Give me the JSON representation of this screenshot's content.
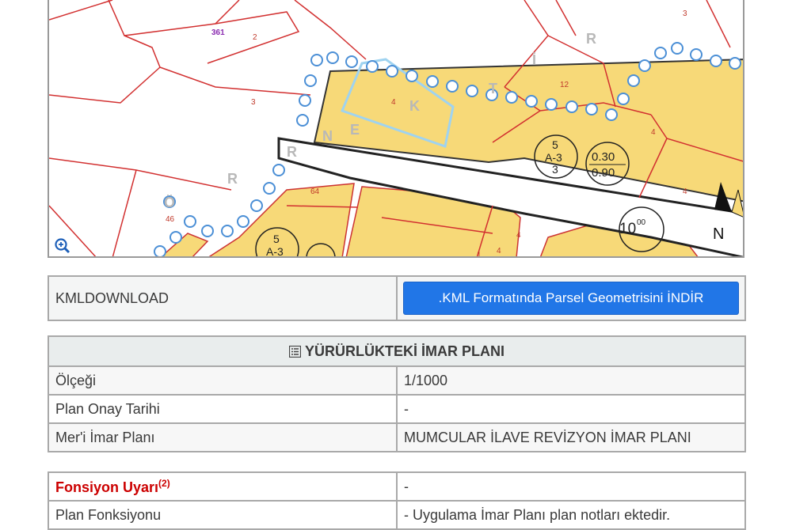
{
  "map": {
    "parcel_labels": [
      "361",
      "2",
      "3",
      "3",
      "4",
      "12",
      "4",
      "64",
      "4",
      "1",
      "4",
      "46",
      "4"
    ],
    "street_letters": [
      "R",
      "Ö",
      "R",
      "N",
      "E",
      "K",
      "T",
      "İ",
      "R"
    ],
    "zoning_code_1": {
      "top": "5",
      "mid": "A-3",
      "bot": "3"
    },
    "zoning_ratio": {
      "top": "0.30",
      "bot": "0.90"
    },
    "zoning_code_2": {
      "top": "5",
      "mid": "A-3"
    },
    "road_width": "10",
    "road_width_sup": "00",
    "north": "N",
    "zoom_icon": "magnifier-plus-icon"
  },
  "kml": {
    "label": "KMLDOWNLOAD",
    "button_label": ".KML Formatında Parsel Geometrisini İNDİR",
    "button_color": "#2176e7"
  },
  "plan": {
    "header_icon": "list-document-icon",
    "header": "YÜRÜRLÜKTEKİ İMAR PLANI",
    "rows": [
      {
        "label": "Ölçeği",
        "value": "1/1000"
      },
      {
        "label": "Plan Onay Tarihi",
        "value": "-"
      },
      {
        "label": "Mer'i İmar Planı",
        "value": "MUMCULAR İLAVE REVİZYON İMAR PLANI"
      }
    ]
  },
  "function": {
    "warning_label": "Fonsiyon Uyarı",
    "warning_sup": "(2)",
    "warning_value": "-",
    "warning_color": "#cc0000",
    "plan_function_label": "Plan Fonksiyonu",
    "plan_function_value": "- Uygulama İmar Planı plan notları ektedir."
  }
}
